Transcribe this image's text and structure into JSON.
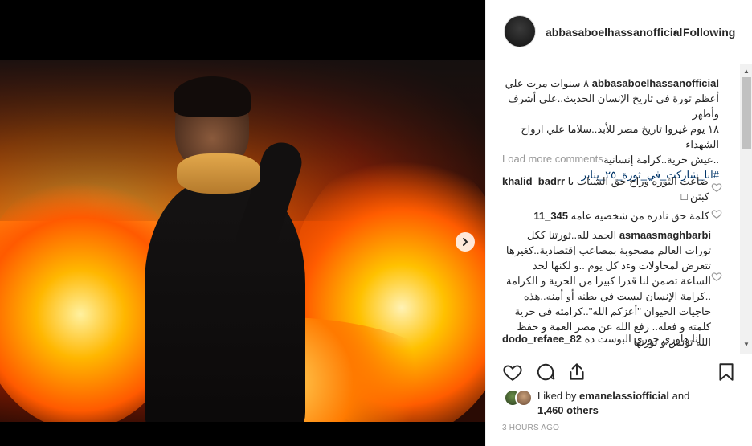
{
  "post": {
    "username": "abbasaboelhassanofficial",
    "separator": "•",
    "follow_state": "Following",
    "caption": {
      "lines": [
        "٨ سنوات مرت علي",
        "أعظم ثورة في تاريخ الإنسان الحديث..علي أشرف وأطهر",
        "١٨ يوم غيروا تاريخ مصر للأبد..سلاما علي ارواح الشهداء",
        "..عيش حرية..كرامة إنسانية"
      ],
      "hashtag": "#انا_شاركت_في_ثورة_٢٥_يناير"
    },
    "load_more": "Load more comments",
    "comments": [
      {
        "username": "khalid_badrr",
        "text": "ضاعت الثوره وراح حق الشباب يا",
        "text2": "كبتن □"
      },
      {
        "username": "345_11",
        "text": "كلمة حق نادره من شخصيه عامه"
      },
      {
        "username": "asmaasmaghbarbi",
        "text": "الحمد لله..ثورتنا ككل ثورات العالم مصحوبة بمصاعب إقتصادية..كغيرها تتعرض لمحاولات وءد كل يوم ..و لكنها لحد الساعة تضمن لنا قدرا كبيرا من الحرية و الكرامة ..كرامة الإنسان ليست في بطنه أو أمنه..هذه حاجيات الحيوان \"أعزكم الله\"..كرامته في حرية كلمته و فعله.. رفع الله عن مصر الغمة و حفظ الله تونس و ثورتها"
      },
      {
        "username": "dodo_refaee_82",
        "text": "انا هاوري جوزي البوست ده"
      }
    ],
    "liked_by_prefix": "Liked by",
    "liked_by_user": "emanelassiofficial",
    "liked_by_and": "and",
    "liked_by_others": "1,460 others",
    "timestamp": "3 HOURS AGO"
  },
  "icons": {
    "like": "heart-icon",
    "comment": "comment-icon",
    "share": "share-icon",
    "save": "bookmark-icon",
    "next": "chevron-right-icon"
  }
}
